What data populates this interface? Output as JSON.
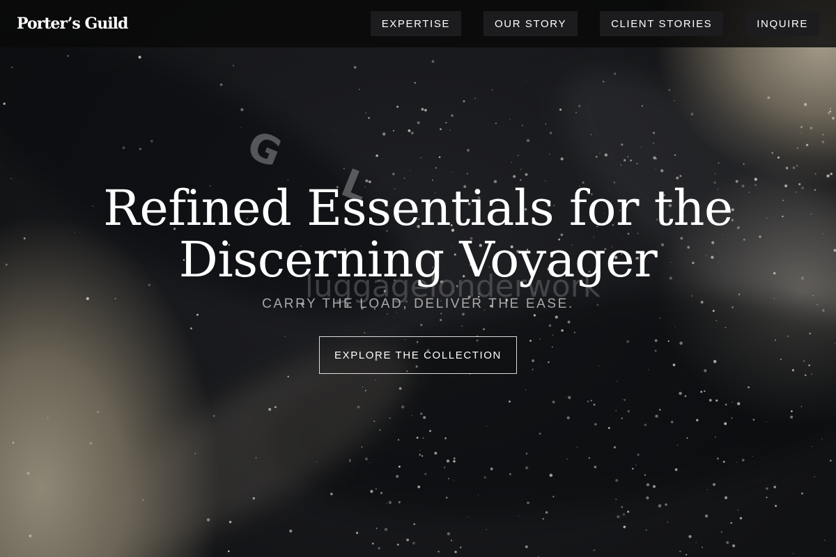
{
  "header": {
    "logo": "Porter’s Guild",
    "nav": [
      {
        "label": "EXPERTISE"
      },
      {
        "label": "OUR STORY"
      },
      {
        "label": "CLIENT STORIES"
      },
      {
        "label": "INQUIRE"
      }
    ]
  },
  "hero": {
    "headline_line1": "Refined Essentials for the",
    "headline_line2": "Discerning Voyager",
    "background_text": "luggagelonderwork",
    "tagline": "CARRY THE LOAD, DELIVER THE EASE.",
    "cta_label": "EXPLORE THE COLLECTION"
  }
}
